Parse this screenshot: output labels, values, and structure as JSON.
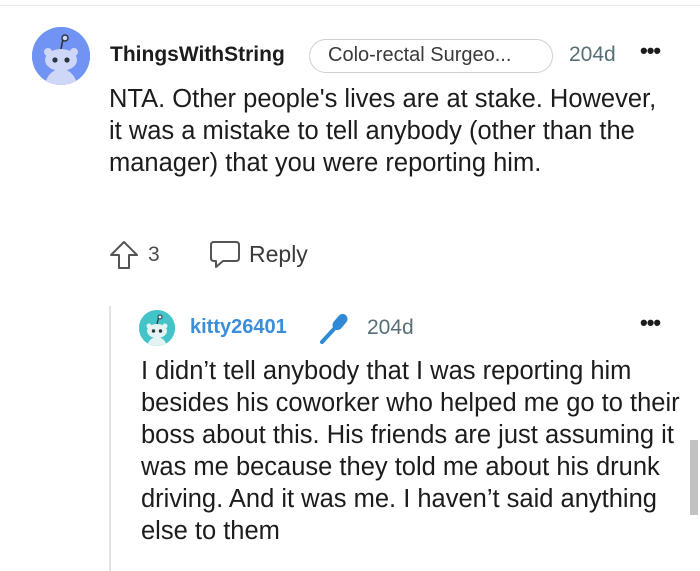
{
  "comment": {
    "username": "ThingsWithString",
    "flair": "Colo-rectal Surgeo...",
    "time": "204d",
    "more": "•••",
    "body": "NTA. Other people's lives are at stake. However, it was a mistake to tell anybody (other than the manager) that you were reporting him.",
    "votes": "3",
    "reply_label": "Reply",
    "avatar_color": "#7193f3"
  },
  "reply": {
    "username": "kitty26401",
    "username_color": "#3b8ed9",
    "badge_icon": "microphone-icon",
    "time": "204d",
    "more": "•••",
    "body": "I didn’t tell anybody that I was reporting him besides his coworker who helped me go to their boss about this. His friends are just assuming it was me because they told me about his drunk driving. And it was me. I haven’t said anything else to them",
    "avatar_color": "#43c4c8"
  }
}
